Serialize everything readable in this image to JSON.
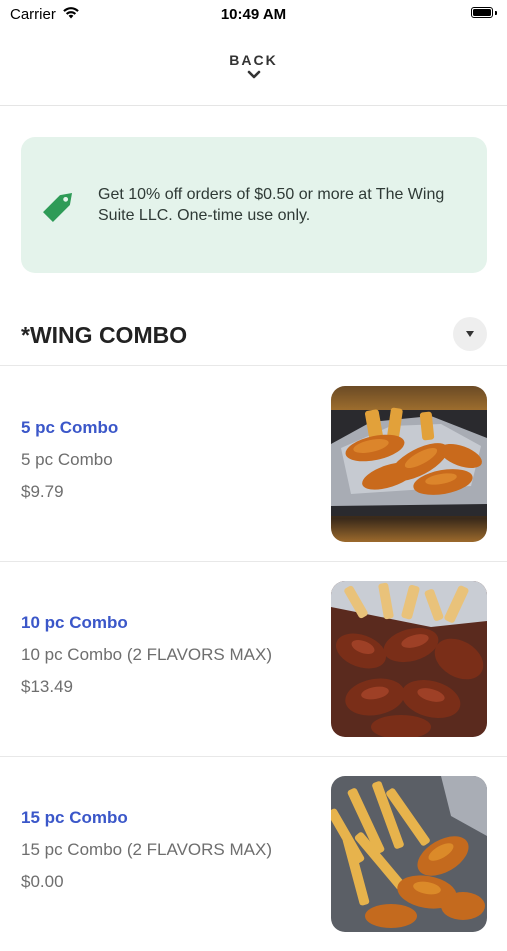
{
  "status_bar": {
    "carrier": "Carrier",
    "time": "10:49 AM"
  },
  "nav": {
    "back_label": "BACK"
  },
  "promo": {
    "text": "Get 10% off orders of $0.50 or more at The Wing Suite LLC. One-time use only.",
    "accent": "#2e9b57"
  },
  "section": {
    "title": "*WING COMBO"
  },
  "items": [
    {
      "name": "5 pc Combo",
      "description": "5 pc Combo",
      "price": "$9.79"
    },
    {
      "name": "10 pc Combo",
      "description": "10 pc Combo (2 FLAVORS MAX)",
      "price": "$13.49"
    },
    {
      "name": "15 pc Combo",
      "description": "15 pc Combo (2 FLAVORS MAX)",
      "price": "$0.00"
    }
  ]
}
